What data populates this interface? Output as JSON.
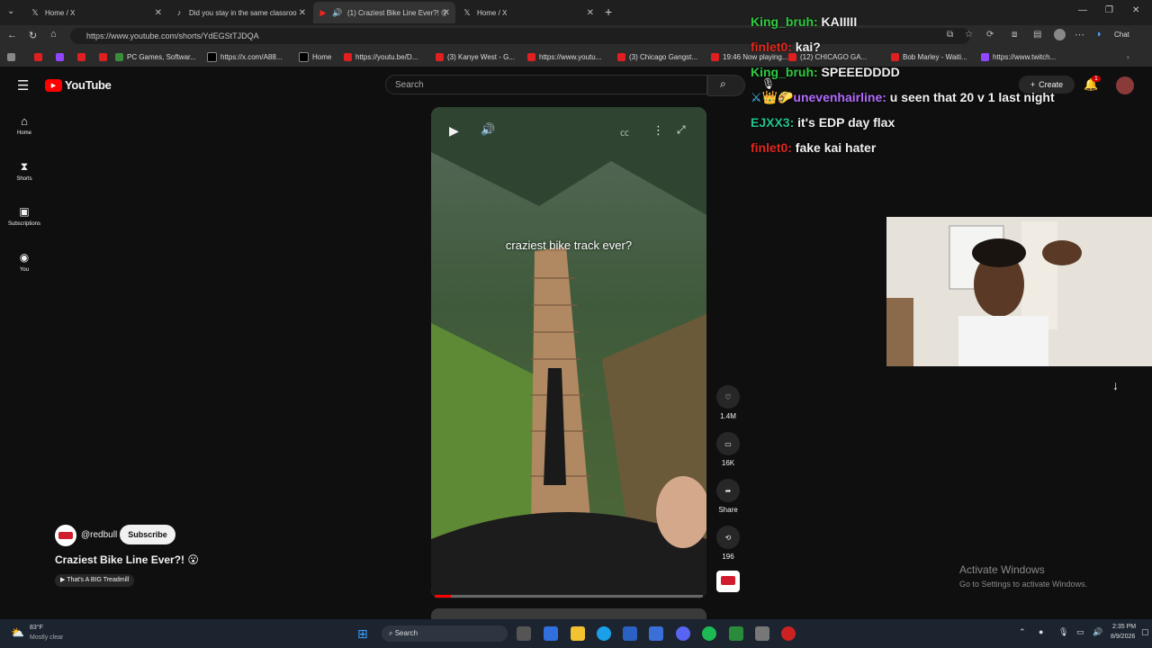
{
  "tabs": [
    {
      "label": "Home / X",
      "icon": "x-logo-icon"
    },
    {
      "label": "Did you stay in the same classroo",
      "icon": "tiktok-icon"
    },
    {
      "label": "(1) Craziest Bike Line Ever?! 😮",
      "icon": "youtube-icon"
    },
    {
      "label": "Home / X",
      "icon": "x-logo-icon"
    }
  ],
  "address": {
    "url": "https://www.youtube.com/shorts/YdEGStTJDQA"
  },
  "browser": {
    "chat_label": "Chat"
  },
  "bookmarks": [
    "PC Games, Softwar...",
    "https://x.com/A88...",
    "Home",
    "https://youtu.be/D...",
    "(3) Kanye West - G...",
    "https://www.youtu...",
    "(3) Chicago Gangst...",
    "19:46 Now playing...",
    "(12) CHICAGO GA...",
    "Bob Marley - Waiti...",
    "https://www.twitch..."
  ],
  "youtube": {
    "logo_text": "YouTube",
    "search_placeholder": "Search",
    "create_label": "Create",
    "notif_count": "1",
    "nav": [
      "Home",
      "Shorts",
      "Subscriptions",
      "You"
    ],
    "video_caption": "craziest bike track ever?",
    "channel": "@redbull",
    "subscribe_label": "Subscribe",
    "title": "Craziest Bike Line Ever?! 😮",
    "playlist": "That's A BIG Treadmill",
    "likes": "1.4M",
    "comments": "16K",
    "share_label": "Share",
    "remix_count": "196"
  },
  "chat": [
    {
      "user": "King_bruh:",
      "msg": "KAIIIII",
      "color": "#2ecc40"
    },
    {
      "user": "finlet0:",
      "msg": "kai?",
      "color": "#e0281e"
    },
    {
      "user": "King_bruh:",
      "msg": "SPEEEDDDD",
      "color": "#2ecc40"
    },
    {
      "user": "unevenhairline:",
      "msg": "u seen that 20 v 1 last night",
      "color": "#b36bff"
    },
    {
      "user": "EJXX3:",
      "msg": "it's EDP day flax",
      "color": "#23c28f"
    },
    {
      "user": "finlet0:",
      "msg": "fake kai hater",
      "color": "#e0281e"
    }
  ],
  "activate": {
    "title": "Activate Windows",
    "subtitle": "Go to Settings to activate Windows."
  },
  "taskbar": {
    "weather_temp": "83°F",
    "weather_desc": "Mostly clear",
    "search_label": "Search",
    "time": "2:35 PM",
    "date": "8/9/2026"
  }
}
